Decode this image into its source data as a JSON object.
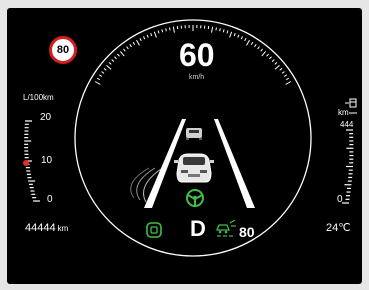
{
  "speed_limit_sign": "80",
  "speed": {
    "value": "60",
    "unit": "km/h"
  },
  "fuel_consumption": {
    "unit": "L/100km",
    "ticks": [
      "20",
      "10",
      "0"
    ],
    "current": 10
  },
  "odometer": {
    "value": "44444",
    "unit": "km"
  },
  "range": {
    "unit": "km",
    "value": "444",
    "tick": "0"
  },
  "outside_temperature": "24℃",
  "gear": "D",
  "cruise_set_speed": "80",
  "colors": {
    "background": "#000000",
    "text": "#ffffff",
    "active_indicator": "#3fbf4a",
    "fuel_marker": "#e02b2b",
    "speed_limit_ring": "#d21e1e"
  },
  "icons": {
    "fuel_pump": "fuel-pump-icon",
    "lane_keeping": "steering-wheel-icon",
    "adaptive_cruise": "vehicle-distance-icon",
    "driver_assist": "car-radar-icon"
  }
}
